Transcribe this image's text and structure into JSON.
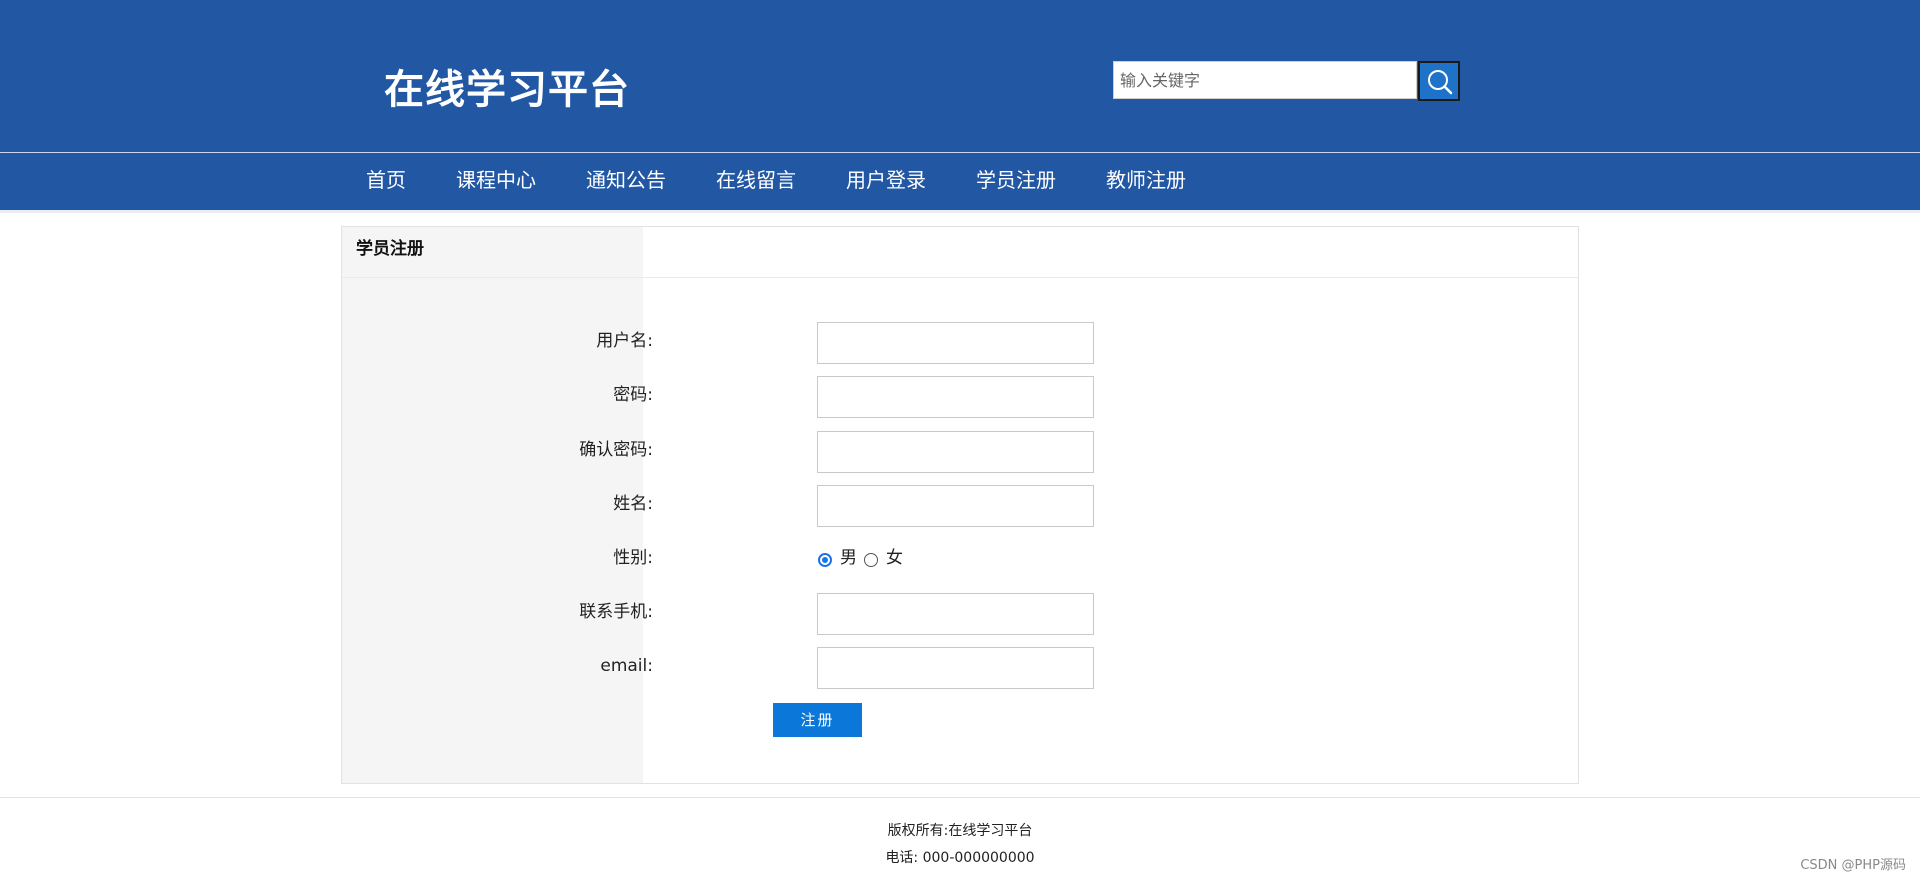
{
  "header": {
    "site_title": "在线学习平台",
    "search_placeholder": "输入关键字",
    "search_icon": "search-icon"
  },
  "nav": {
    "items": [
      {
        "label": "首页"
      },
      {
        "label": "课程中心"
      },
      {
        "label": "通知公告"
      },
      {
        "label": "在线留言"
      },
      {
        "label": "用户登录"
      },
      {
        "label": "学员注册"
      },
      {
        "label": "教师注册"
      }
    ]
  },
  "panel": {
    "title": "学员注册"
  },
  "form": {
    "username_label": "用户名:",
    "password_label": "密码:",
    "confirm_password_label": "确认密码:",
    "name_label": "姓名:",
    "gender_label": "性别:",
    "gender_options": [
      {
        "label": "男",
        "checked": true
      },
      {
        "label": "女",
        "checked": false
      }
    ],
    "phone_label": "联系手机:",
    "email_label": "email:",
    "submit_label": "注册"
  },
  "footer": {
    "copyright": "版权所有:在线学习平台",
    "phone": "电话: 000-000000000"
  },
  "watermark": "CSDN @PHP源码",
  "colors": {
    "header_bg": "#2257a3",
    "submit_bg": "#0b78d9",
    "search_button_bg": "#1e73c9"
  }
}
